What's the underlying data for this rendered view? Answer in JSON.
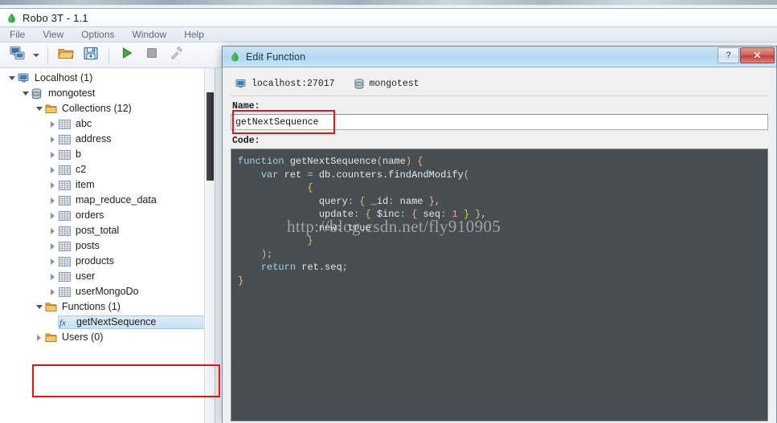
{
  "app": {
    "title": "Robo 3T - 1.1",
    "logo_icon": "robo3t-leaf-icon",
    "menu": [
      {
        "label": "File"
      },
      {
        "label": "View"
      },
      {
        "label": "Options"
      },
      {
        "label": "Window"
      },
      {
        "label": "Help"
      }
    ],
    "toolbar": [
      {
        "icon": "connect-computer-icon",
        "name": "connect-button"
      },
      {
        "icon": "chevron-down-icon",
        "name": "connect-dropdown-button"
      },
      {
        "icon": "open-folder-icon",
        "name": "open-script-button"
      },
      {
        "icon": "save-floppy-icon",
        "name": "save-script-button"
      },
      {
        "icon": "play-icon",
        "name": "execute-button"
      },
      {
        "icon": "stop-square-icon",
        "name": "stop-button"
      },
      {
        "icon": "wrench-icon",
        "name": "tools-button"
      }
    ]
  },
  "tree": {
    "nodes": [
      {
        "label": "Localhost (1)",
        "indent": 0,
        "twisty": "down",
        "icon": "server-icon"
      },
      {
        "label": "mongotest",
        "indent": 1,
        "twisty": "down",
        "icon": "database-icon"
      },
      {
        "label": "Collections (12)",
        "indent": 2,
        "twisty": "down",
        "icon": "folder-icon"
      },
      {
        "label": "abc",
        "indent": 3,
        "twisty": "right",
        "icon": "collection-icon"
      },
      {
        "label": "address",
        "indent": 3,
        "twisty": "right",
        "icon": "collection-icon"
      },
      {
        "label": "b",
        "indent": 3,
        "twisty": "right",
        "icon": "collection-icon"
      },
      {
        "label": "c2",
        "indent": 3,
        "twisty": "right",
        "icon": "collection-icon"
      },
      {
        "label": "item",
        "indent": 3,
        "twisty": "right",
        "icon": "collection-icon"
      },
      {
        "label": "map_reduce_data",
        "indent": 3,
        "twisty": "right",
        "icon": "collection-icon"
      },
      {
        "label": "orders",
        "indent": 3,
        "twisty": "right",
        "icon": "collection-icon"
      },
      {
        "label": "post_total",
        "indent": 3,
        "twisty": "right",
        "icon": "collection-icon"
      },
      {
        "label": "posts",
        "indent": 3,
        "twisty": "right",
        "icon": "collection-icon"
      },
      {
        "label": "products",
        "indent": 3,
        "twisty": "right",
        "icon": "collection-icon"
      },
      {
        "label": "user",
        "indent": 3,
        "twisty": "right",
        "icon": "collection-icon"
      },
      {
        "label": "userMongoDo",
        "indent": 3,
        "twisty": "right",
        "icon": "collection-icon"
      },
      {
        "label": "Functions (1)",
        "indent": 2,
        "twisty": "down",
        "icon": "folder-icon"
      },
      {
        "label": "getNextSequence",
        "indent": 3,
        "twisty": "none",
        "icon": "function-fx-icon",
        "selected": true
      },
      {
        "label": "Users (0)",
        "indent": 2,
        "twisty": "right",
        "icon": "folder-icon"
      }
    ]
  },
  "dialog": {
    "title": "Edit Function",
    "title_icon": "robo3t-leaf-icon",
    "help_button": "?",
    "close_button": "✕",
    "connection": {
      "host_icon": "server-icon",
      "host": "localhost:27017",
      "db_icon": "database-icon",
      "database": "mongotest"
    },
    "name_field": {
      "label": "Name:",
      "value": "getNextSequence"
    },
    "code_field": {
      "label": "Code:",
      "lines": [
        [
          {
            "t": "function ",
            "c": "kw"
          },
          {
            "t": "getNextSequence",
            "c": "fn"
          },
          {
            "t": "(",
            "c": "brc"
          },
          {
            "t": "name",
            "c": "plain"
          },
          {
            "t": ") ",
            "c": "brc"
          },
          {
            "t": "{",
            "c": "brc"
          }
        ],
        [
          {
            "t": "    ",
            "c": "plain"
          },
          {
            "t": "var ",
            "c": "kw"
          },
          {
            "t": "ret ",
            "c": "plain"
          },
          {
            "t": "= ",
            "c": "op"
          },
          {
            "t": "db.counters.findAndModify",
            "c": "plain"
          },
          {
            "t": "(",
            "c": "brc"
          }
        ],
        [
          {
            "t": "            ",
            "c": "plain"
          },
          {
            "t": "{",
            "c": "brc"
          }
        ],
        [
          {
            "t": "              ",
            "c": "plain"
          },
          {
            "t": "query",
            "c": "plain"
          },
          {
            "t": ": ",
            "c": "punc"
          },
          {
            "t": "{ ",
            "c": "brc"
          },
          {
            "t": "_id",
            "c": "plain"
          },
          {
            "t": ": ",
            "c": "punc"
          },
          {
            "t": "name ",
            "c": "plain"
          },
          {
            "t": "}",
            "c": "brc"
          },
          {
            "t": ",",
            "c": "punc"
          }
        ],
        [
          {
            "t": "              ",
            "c": "plain"
          },
          {
            "t": "update",
            "c": "plain"
          },
          {
            "t": ": ",
            "c": "punc"
          },
          {
            "t": "{ ",
            "c": "brc"
          },
          {
            "t": "$inc",
            "c": "plain"
          },
          {
            "t": ": ",
            "c": "punc"
          },
          {
            "t": "{ ",
            "c": "brc"
          },
          {
            "t": "seq",
            "c": "plain"
          },
          {
            "t": ": ",
            "c": "punc"
          },
          {
            "t": "1",
            "c": "num"
          },
          {
            "t": " } }",
            "c": "brc"
          },
          {
            "t": ",",
            "c": "punc"
          }
        ],
        [
          {
            "t": "              ",
            "c": "plain"
          },
          {
            "t": "new",
            "c": "plain"
          },
          {
            "t": ": ",
            "c": "punc"
          },
          {
            "t": "true",
            "c": "plain"
          }
        ],
        [
          {
            "t": "            ",
            "c": "plain"
          },
          {
            "t": "}",
            "c": "brc"
          }
        ],
        [
          {
            "t": "    ",
            "c": "plain"
          },
          {
            "t": ")",
            "c": "brc"
          },
          {
            "t": ";",
            "c": "punc"
          }
        ],
        [
          {
            "t": "    ",
            "c": "plain"
          },
          {
            "t": "return ",
            "c": "kw"
          },
          {
            "t": "ret.seq",
            "c": "plain"
          },
          {
            "t": ";",
            "c": "punc"
          }
        ],
        [
          {
            "t": "}",
            "c": "brc"
          }
        ]
      ]
    },
    "watermark": "http://blog.csdn.net/fly910905"
  },
  "annotations": {
    "accent_color": "#ee1111",
    "name_field_highlight": "red-rectangle-around-name-input",
    "tree_functions_highlight": "red-rectangle-around-functions-node"
  }
}
